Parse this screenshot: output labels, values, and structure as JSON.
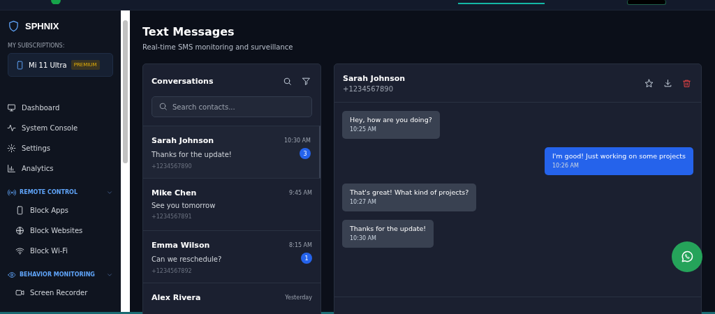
{
  "sidebar": {
    "brand": "SPHNIX",
    "subscriptions_label": "MY SUBSCRIPTIONS:",
    "device": {
      "name": "Mi 11 Ultra",
      "badge": "PREMIUM"
    },
    "nav_items": [
      {
        "label": "Dashboard",
        "selected": false
      },
      {
        "label": "System Console",
        "selected": false
      },
      {
        "label": "Settings",
        "selected": false
      },
      {
        "label": "Analytics",
        "selected": false
      }
    ],
    "sections": [
      {
        "title": "REMOTE CONTROL",
        "expanded": true,
        "items": [
          {
            "label": "Block Apps"
          },
          {
            "label": "Block Websites"
          },
          {
            "label": "Block Wi-Fi"
          }
        ]
      },
      {
        "title": "BEHAVIOR MONITORING",
        "expanded": true,
        "items": [
          {
            "label": "Screen Recorder"
          }
        ]
      }
    ]
  },
  "page": {
    "title": "Text Messages",
    "subtitle": "Real-time SMS monitoring and surveillance"
  },
  "conversations": {
    "title": "Conversations",
    "search": {
      "placeholder": "Search contacts..."
    },
    "items": [
      {
        "name": "Sarah Johnson",
        "time": "10:30 AM",
        "preview": "Thanks for the update!",
        "phone": "+1234567890",
        "unread": "3",
        "selected": true
      },
      {
        "name": "Mike Chen",
        "time": "9:45 AM",
        "preview": "See you tomorrow",
        "phone": "+1234567891",
        "selected": false
      },
      {
        "name": "Emma Wilson",
        "time": "8:15 AM",
        "preview": "Can we reschedule?",
        "phone": "+1234567892",
        "unread": "1",
        "selected": false
      },
      {
        "name": "Alex Rivera",
        "time": "Yesterday",
        "selected": false
      }
    ]
  },
  "chat": {
    "name": "Sarah Johnson",
    "phone": "+1234567890",
    "messages": [
      {
        "text": "Hey, how are you doing?",
        "time": "10:25 AM",
        "outgoing": false
      },
      {
        "text": "I'm good! Just working on some projects",
        "time": "10:26 AM",
        "outgoing": true
      },
      {
        "text": "That's great! What kind of projects?",
        "time": "10:27 AM",
        "outgoing": false
      },
      {
        "text": "Thanks for the update!",
        "time": "10:30 AM",
        "outgoing": false
      }
    ]
  }
}
